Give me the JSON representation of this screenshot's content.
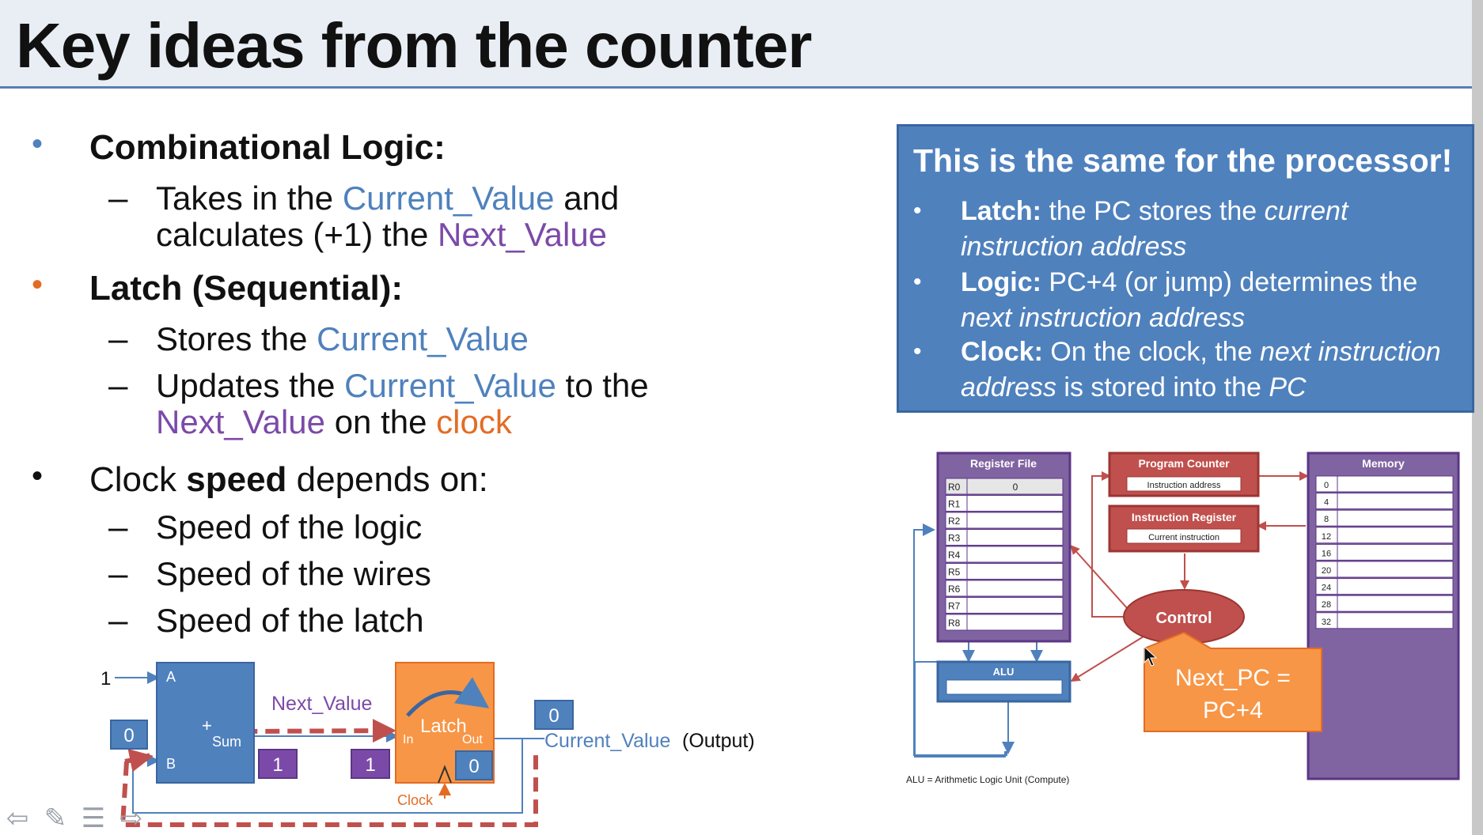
{
  "slide_title": "Key ideas from the counter",
  "left": {
    "b1_title": "Combinational Logic:",
    "b1_s1_a": "Takes in the ",
    "b1_s1_b": "Current_Value",
    "b1_s1_c": " and",
    "b1_s1_d": "calculates (+1) the ",
    "b1_s1_e": "Next_Value",
    "b2_title": "Latch (Sequential):",
    "b2_s1_a": "Stores the ",
    "b2_s1_b": "Current_Value",
    "b2_s2_a": "Updates the ",
    "b2_s2_b": "Current_Value",
    "b2_s2_c": " to the",
    "b2_s2_d": "Next_Value",
    "b2_s2_e": " on the ",
    "b2_s2_f": "clock",
    "b3_a": "Clock ",
    "b3_b": "speed",
    "b3_c": " depends on:",
    "b3_s1": "Speed of the logic",
    "b3_s2": "Speed of the wires",
    "b3_s3": "Speed of the latch",
    "dash": "–",
    "bullet": "•"
  },
  "infobox": {
    "title": "This is the same for the processor!",
    "l1_a": "Latch:",
    "l1_b": " the PC stores the ",
    "l1_c": "current",
    "l1_d": "instruction address",
    "l2_a": "Logic:",
    "l2_b": " PC+4 (or jump) determines the",
    "l2_c": "next instruction address",
    "l3_a": "Clock:",
    "l3_b": " On the clock, the ",
    "l3_c": "next instruction",
    "l3_d": "address",
    "l3_e": " is stored into the ",
    "l3_f": "PC"
  },
  "counter_diagram": {
    "const_one": "1",
    "adder_a": "A",
    "adder_b": "B",
    "adder_plus": "+",
    "adder_sum": "Sum",
    "next_value_label": "Next_Value",
    "latch_label": "Latch",
    "latch_in": "In",
    "latch_out": "Out",
    "clock_label": "Clock",
    "current_value_label": "Current_Value",
    "output_label": "(Output)",
    "box_b_value": "0",
    "box_sum_value": "1",
    "box_next_value": "1",
    "box_latch_out_value": "0",
    "box_output_value": "0"
  },
  "processor_diagram": {
    "register_file_title": "Register File",
    "registers": [
      "R0",
      "R1",
      "R2",
      "R3",
      "R4",
      "R5",
      "R6",
      "R7",
      "R8"
    ],
    "r0_value": "0",
    "pc_title": "Program Counter",
    "pc_field": "Instruction address",
    "ir_title": "Instruction Register",
    "ir_field": "Current instruction",
    "memory_title": "Memory",
    "memory_addresses": [
      "0",
      "4",
      "8",
      "12",
      "16",
      "20",
      "24",
      "28",
      "32"
    ],
    "control_label": "Control",
    "alu_label": "ALU",
    "callout_line1": "Next_PC =",
    "callout_line2": "PC+4",
    "footnote": "ALU = Arithmetic Logic Unit (Compute)"
  },
  "colors": {
    "blue": "#4f81bd",
    "purple": "#7b4aa8",
    "orange": "#e36c24",
    "red": "#c0504d",
    "callout_orange": "#f79646"
  },
  "nav_icons": [
    "back-arrow-icon",
    "pen-icon",
    "menu-icon",
    "forward-arrow-icon"
  ]
}
